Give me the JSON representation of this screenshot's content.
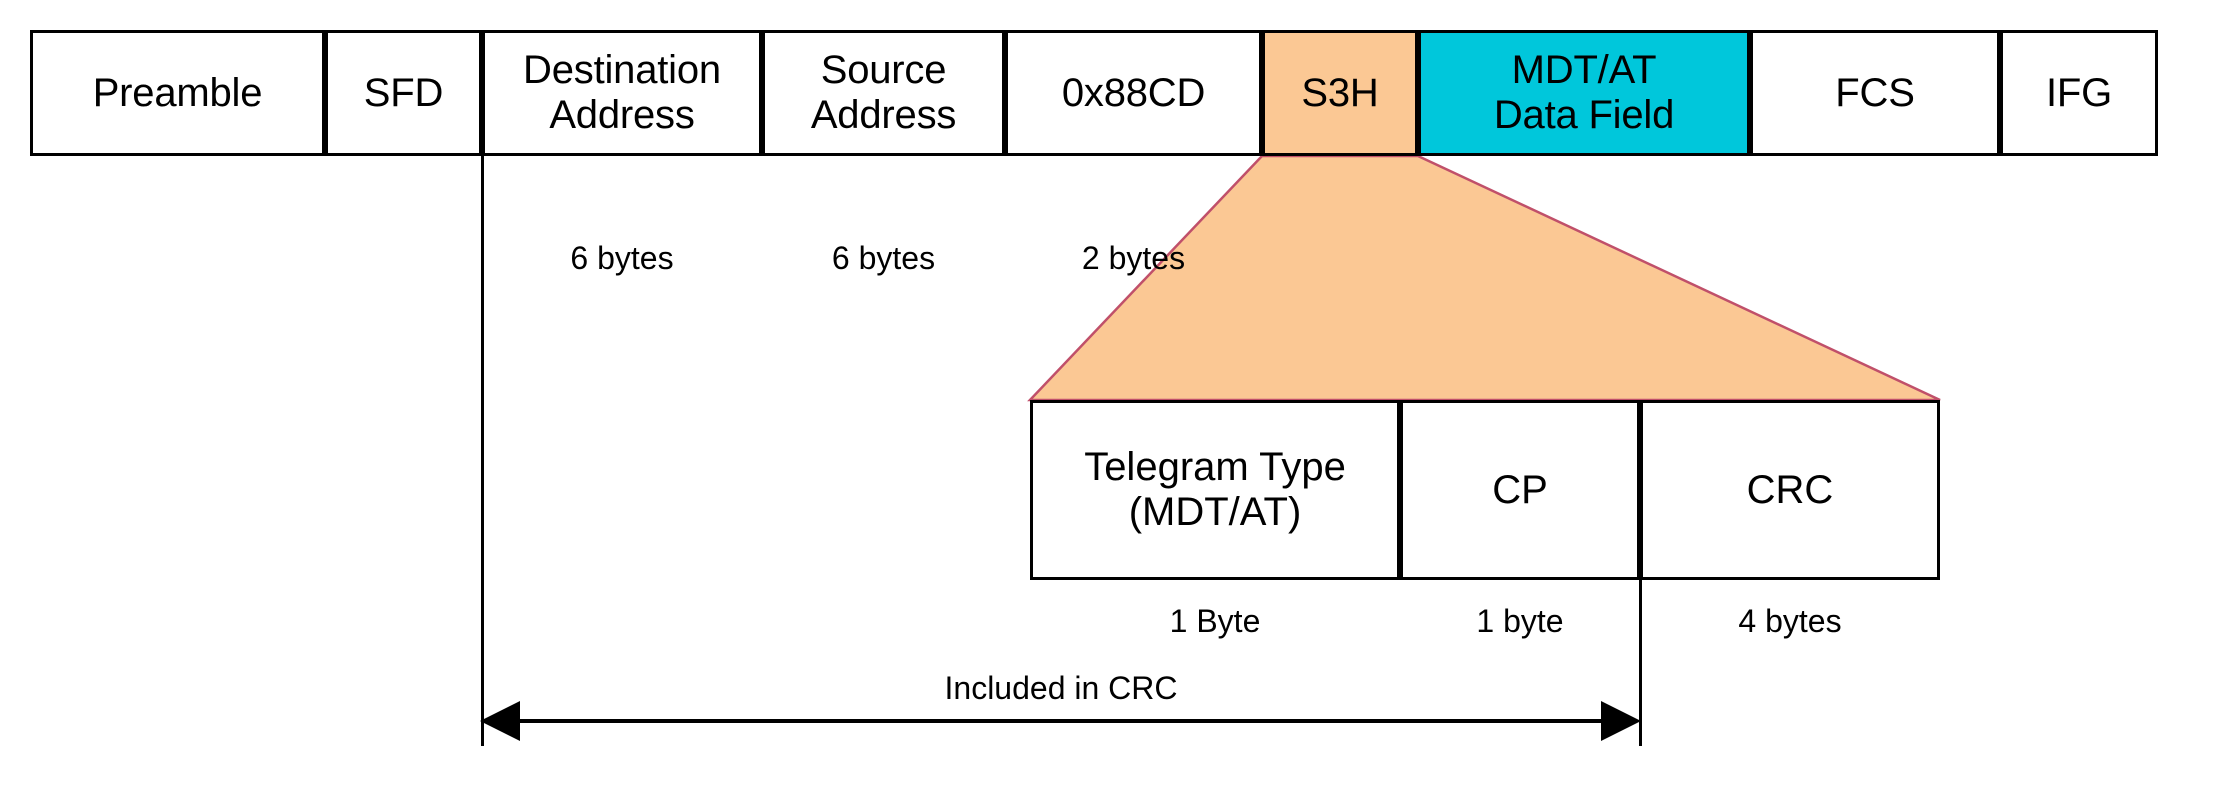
{
  "diagram": {
    "title": "Ethernet frame with S3H and MDT/AT data field",
    "colors": {
      "s3h_fill": "#FBC894",
      "data_field_fill": "#00C7DB",
      "callout_fill": "#FBC894",
      "callout_stroke": "#C0506A",
      "line": "#000000"
    }
  },
  "frame": {
    "cells": [
      {
        "label": "Preamble",
        "line1": "Preamble",
        "line2": ""
      },
      {
        "label": "SFD",
        "line1": "SFD",
        "line2": ""
      },
      {
        "label": "Destination Address",
        "line1": "Destination",
        "line2": "Address"
      },
      {
        "label": "Source Address",
        "line1": "Source",
        "line2": "Address"
      },
      {
        "label": "0x88CD",
        "line1": "0x88CD",
        "line2": ""
      },
      {
        "label": "S3H",
        "line1": "S3H",
        "line2": ""
      },
      {
        "label": "MDT/AT Data Field",
        "line1": "MDT/AT",
        "line2": "Data Field"
      },
      {
        "label": "FCS",
        "line1": "FCS",
        "line2": ""
      },
      {
        "label": "IFG",
        "line1": "IFG",
        "line2": ""
      }
    ],
    "size_labels": [
      {
        "text": "6 bytes"
      },
      {
        "text": "6 bytes"
      },
      {
        "text": "2 bytes"
      }
    ]
  },
  "detail": {
    "cells": [
      {
        "label": "Telegram Type (MDT/AT)",
        "line1": "Telegram Type",
        "line2": "(MDT/AT)"
      },
      {
        "label": "CP",
        "line1": "CP",
        "line2": ""
      },
      {
        "label": "CRC",
        "line1": "CRC",
        "line2": ""
      }
    ],
    "size_labels": [
      {
        "text": "1 Byte"
      },
      {
        "text": "1 byte"
      },
      {
        "text": "4 bytes"
      }
    ]
  },
  "crc_span": {
    "caption": "Included in CRC"
  }
}
